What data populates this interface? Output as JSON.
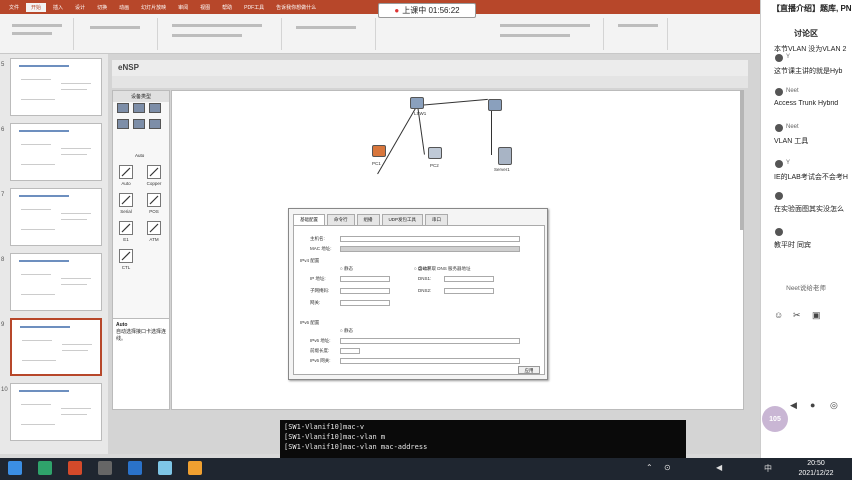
{
  "ppt": {
    "tabs": [
      "文件",
      "开始",
      "插入",
      "设计",
      "切换",
      "动画",
      "幻灯片放映",
      "审阅",
      "视图",
      "帮助",
      "PDF工具",
      "告诉我你想做什么"
    ],
    "active_tab": "开始",
    "accent": "#b7472a"
  },
  "live_banner": {
    "record_icon": "●",
    "text": "上课中 01:56:22"
  },
  "thumbnails": [
    {
      "num": "5"
    },
    {
      "num": "6"
    },
    {
      "num": "7"
    },
    {
      "num": "8"
    },
    {
      "num": "9"
    },
    {
      "num": "10"
    }
  ],
  "ensp": {
    "title": "eNSP",
    "panel_title": "设备类型",
    "tools": [
      "Auto",
      "Copper",
      "Serial",
      "POS",
      "E1",
      "ATM",
      "CTL"
    ],
    "hint_title": "Auto",
    "hint_text": "自动选择接口卡选择连线。",
    "nodes": [
      "LSW1",
      "PC1",
      "PC2",
      "Server1"
    ]
  },
  "dialog": {
    "tabs": [
      "基础配置",
      "命令行",
      "组播",
      "UDP发包工具",
      "串口"
    ],
    "fields": [
      "主机名:",
      "MAC 地址:"
    ],
    "ipv4_label": "IPv4 配置",
    "static_label": "静态",
    "dhcp_label": "DHCP",
    "ip_label": "IP 地址:",
    "mask_label": "子网掩码:",
    "gw_label": "网关:",
    "dns1_label": "DNS1:",
    "dns2_label": "DNS2:",
    "auto_dns": "自动获取 DNS 服务器地址",
    "ipv6_label": "IPv6 配置",
    "ipv6_fields": [
      "IPv6 地址:",
      "前缀长度:",
      "IPv6 网关:"
    ],
    "ok": "应用"
  },
  "terminal": {
    "lines": [
      "[SW1-Vlanif10]mac-v",
      "[SW1-Vlanif10]mac-vlan m",
      "[SW1-Vlanif10]mac-vlan mac-address"
    ]
  },
  "chat": {
    "header": "【直播介绍】题库, PN",
    "title": "讨论区",
    "messages": [
      {
        "name": "",
        "text": "本节VLAN 没为VLAN 2"
      },
      {
        "name": "Y",
        "text": "这节课主讲的就是Hyb"
      },
      {
        "name": "Neet",
        "text": "Access Trunk Hybrid"
      },
      {
        "name": "Neet",
        "text": "VLAN 工具"
      },
      {
        "name": "Y",
        "text": "IE的LAB考试会不会考H"
      },
      {
        "name": "",
        "text": "在实验面图其实没怎么"
      },
      {
        "name": "",
        "text": "教平时 同宾"
      }
    ],
    "footer": "Neet说给老师",
    "logo": "105"
  },
  "taskbar": {
    "time": "20:50",
    "date": "2021/12/22",
    "ime": "中"
  }
}
